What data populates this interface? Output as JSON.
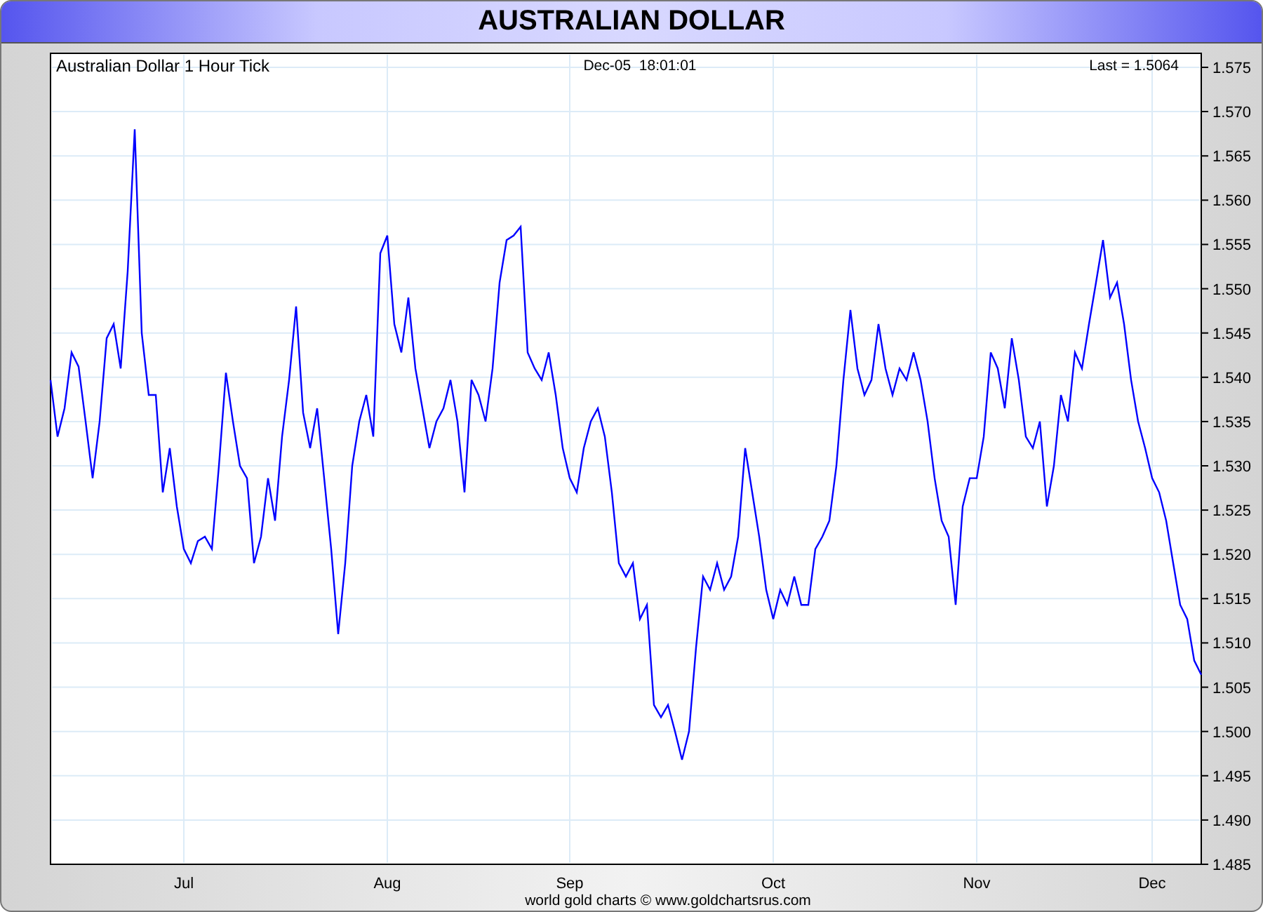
{
  "window": {
    "title": "AUSTRALIAN DOLLAR"
  },
  "chart": {
    "timestamp": "Dec-05  18:01:01",
    "last": "Last = 1.5064",
    "footer": "world gold charts © www.goldchartsrus.com",
    "chart_data": {
      "type": "line",
      "title": "Australian Dollar 1 Hour Tick",
      "grid": true,
      "ylim": [
        1.485,
        1.575
      ],
      "categories": [
        null,
        null,
        null,
        null,
        null,
        null,
        null,
        null,
        null,
        null,
        null,
        null,
        null,
        null,
        null,
        null,
        null,
        null,
        null,
        "Jul",
        null,
        null,
        null,
        null,
        null,
        null,
        null,
        null,
        null,
        null,
        null,
        null,
        null,
        null,
        null,
        null,
        null,
        null,
        null,
        null,
        null,
        null,
        null,
        null,
        null,
        null,
        null,
        null,
        "Aug",
        null,
        null,
        null,
        null,
        null,
        null,
        null,
        null,
        null,
        null,
        null,
        null,
        null,
        null,
        null,
        null,
        null,
        null,
        null,
        null,
        null,
        null,
        null,
        null,
        null,
        "Sep",
        null,
        null,
        null,
        null,
        null,
        null,
        null,
        null,
        null,
        null,
        null,
        null,
        null,
        null,
        null,
        null,
        null,
        null,
        null,
        null,
        null,
        null,
        null,
        null,
        null,
        null,
        null,
        null,
        "Oct",
        null,
        null,
        null,
        null,
        null,
        null,
        null,
        null,
        null,
        null,
        null,
        null,
        null,
        null,
        null,
        null,
        null,
        null,
        null,
        null,
        null,
        null,
        null,
        null,
        null,
        null,
        null,
        null,
        "Nov",
        null,
        null,
        null,
        null,
        null,
        null,
        null,
        null,
        null,
        null,
        null,
        null,
        null,
        null,
        null,
        null,
        null,
        null,
        null,
        null,
        null,
        null,
        null,
        null,
        "Dec",
        null,
        null,
        null,
        null,
        null,
        null,
        null
      ],
      "yticks": [
        {
          "value": 1.485,
          "label": "1.485"
        },
        {
          "value": 1.49,
          "label": "1.490"
        },
        {
          "value": 1.495,
          "label": "1.495"
        },
        {
          "value": 1.5,
          "label": "1.500"
        },
        {
          "value": 1.505,
          "label": "1.505"
        },
        {
          "value": 1.51,
          "label": "1.510"
        },
        {
          "value": 1.515,
          "label": "1.515"
        },
        {
          "value": 1.52,
          "label": "1.520"
        },
        {
          "value": 1.525,
          "label": "1.525"
        },
        {
          "value": 1.53,
          "label": "1.530"
        },
        {
          "value": 1.535,
          "label": "1.535"
        },
        {
          "value": 1.54,
          "label": "1.540"
        },
        {
          "value": 1.545,
          "label": "1.545"
        },
        {
          "value": 1.55,
          "label": "1.550"
        },
        {
          "value": 1.555,
          "label": "1.555"
        },
        {
          "value": 1.56,
          "label": "1.560"
        },
        {
          "value": 1.565,
          "label": "1.565"
        },
        {
          "value": 1.57,
          "label": "1.570"
        },
        {
          "value": 1.575,
          "label": "1.575"
        }
      ],
      "series": [
        {
          "color": "#0000ff",
          "values": [
            1.5397,
            1.5333,
            1.5365,
            1.5428,
            1.5412,
            1.535,
            1.5286,
            1.535,
            1.5444,
            1.546,
            1.541,
            1.552,
            1.568,
            1.545,
            1.538,
            1.538,
            1.527,
            1.532,
            1.5254,
            1.5206,
            1.519,
            1.5215,
            1.522,
            1.5206,
            1.53,
            1.5405,
            1.535,
            1.53,
            1.5286,
            1.519,
            1.522,
            1.5286,
            1.5238,
            1.5333,
            1.5397,
            1.548,
            1.536,
            1.532,
            1.5365,
            1.5286,
            1.5206,
            1.511,
            1.519,
            1.53,
            1.535,
            1.538,
            1.5333,
            1.554,
            1.556,
            1.546,
            1.5428,
            1.549,
            1.541,
            1.5365,
            1.532,
            1.535,
            1.5365,
            1.5397,
            1.535,
            1.527,
            1.5397,
            1.538,
            1.535,
            1.541,
            1.5507,
            1.5555,
            1.556,
            1.557,
            1.5428,
            1.541,
            1.5397,
            1.5428,
            1.538,
            1.532,
            1.5286,
            1.527,
            1.532,
            1.535,
            1.5365,
            1.5333,
            1.527,
            1.519,
            1.5175,
            1.519,
            1.5127,
            1.5143,
            1.503,
            1.5016,
            1.503,
            1.5,
            1.4968,
            1.5,
            1.5095,
            1.5175,
            1.516,
            1.519,
            1.516,
            1.5175,
            1.522,
            1.532,
            1.527,
            1.522,
            1.516,
            1.5127,
            1.516,
            1.5143,
            1.5175,
            1.5143,
            1.5143,
            1.5206,
            1.522,
            1.5238,
            1.53,
            1.5397,
            1.5476,
            1.541,
            1.538,
            1.5397,
            1.546,
            1.541,
            1.538,
            1.541,
            1.5397,
            1.5428,
            1.5397,
            1.535,
            1.5286,
            1.5238,
            1.522,
            1.5143,
            1.5254,
            1.5286,
            1.5286,
            1.5333,
            1.5428,
            1.541,
            1.5365,
            1.5444,
            1.5397,
            1.5333,
            1.532,
            1.535,
            1.5254,
            1.53,
            1.538,
            1.535,
            1.5428,
            1.541,
            1.546,
            1.5507,
            1.5555,
            1.549,
            1.5507,
            1.546,
            1.5397,
            1.535,
            1.532,
            1.5286,
            1.527,
            1.5238,
            1.519,
            1.5143,
            1.5127,
            1.508,
            1.5064
          ]
        }
      ]
    }
  }
}
